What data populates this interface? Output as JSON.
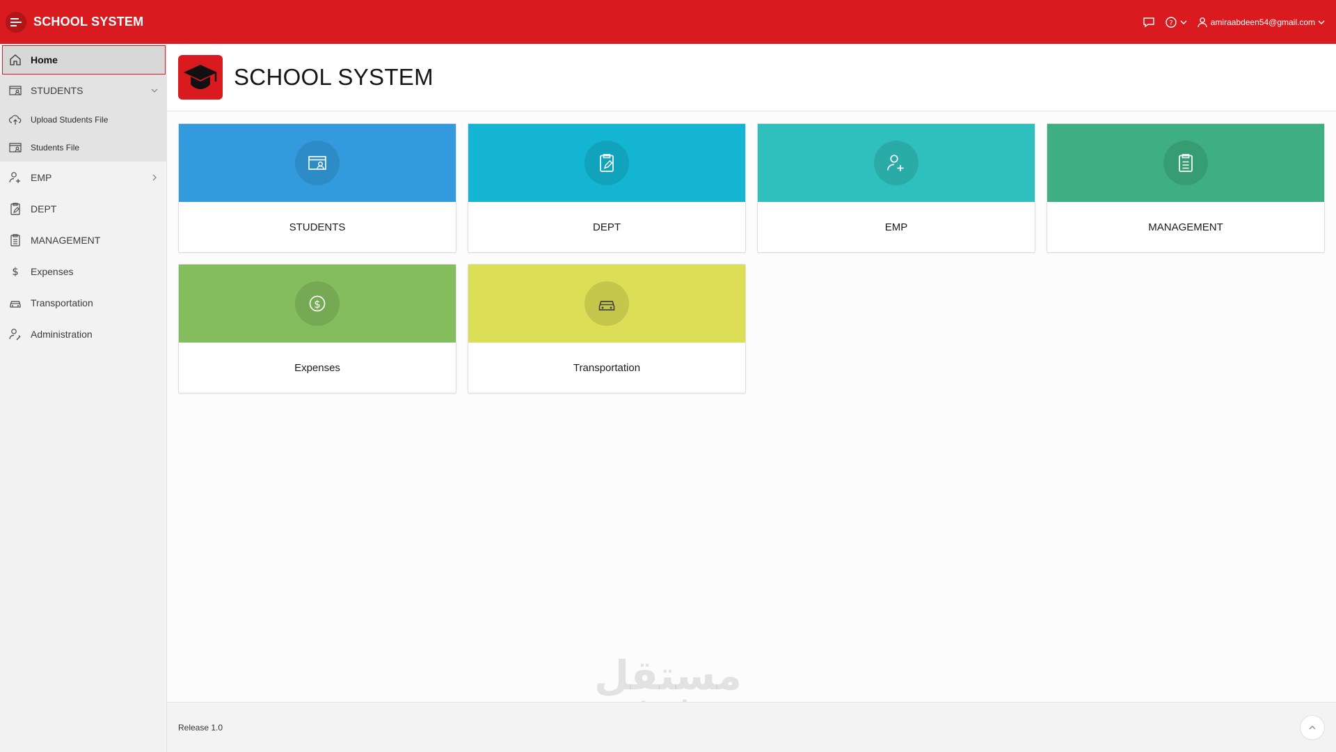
{
  "header": {
    "app_title": "SCHOOL SYSTEM",
    "user_email": "amiraabdeen54@gmail.com",
    "icons": [
      "menu-icon",
      "chat-icon",
      "help-icon",
      "user-icon"
    ],
    "color": "#d91a1e"
  },
  "sidebar": {
    "items": [
      {
        "label": "Home",
        "icon": "home-icon",
        "active": true
      },
      {
        "label": "STUDENTS",
        "icon": "students-icon",
        "expanded": true,
        "children": [
          {
            "label": "Upload Students File",
            "icon": "cloud-upload-icon"
          },
          {
            "label": "Students File",
            "icon": "id-card-icon"
          }
        ]
      },
      {
        "label": "EMP",
        "icon": "user-add-icon",
        "collapsed": true
      },
      {
        "label": "DEPT",
        "icon": "clipboard-edit-icon"
      },
      {
        "label": "MANAGEMENT",
        "icon": "clipboard-list-icon"
      },
      {
        "label": "Expenses",
        "icon": "dollar-icon"
      },
      {
        "label": "Transportation",
        "icon": "car-icon"
      },
      {
        "label": "Administration",
        "icon": "user-wrench-icon"
      }
    ]
  },
  "page": {
    "title": "SCHOOL SYSTEM"
  },
  "cards": [
    {
      "label": "STUDENTS",
      "color": "#339bdd",
      "icon": "students-icon"
    },
    {
      "label": "DEPT",
      "color": "#13b5d2",
      "icon": "clipboard-edit-icon"
    },
    {
      "label": "EMP",
      "color": "#2fbfbc",
      "icon": "user-add-icon"
    },
    {
      "label": "MANAGEMENT",
      "color": "#3daf80",
      "icon": "clipboard-list-icon"
    },
    {
      "label": "Expenses",
      "color": "#83bd5d",
      "icon": "dollar-icon"
    },
    {
      "label": "Transportation",
      "color": "#dcde56",
      "icon": "car-icon"
    }
  ],
  "footer": {
    "release": "Release 1.0"
  },
  "watermark": {
    "arabic": "مستقل",
    "latin": "mostaql.com"
  }
}
